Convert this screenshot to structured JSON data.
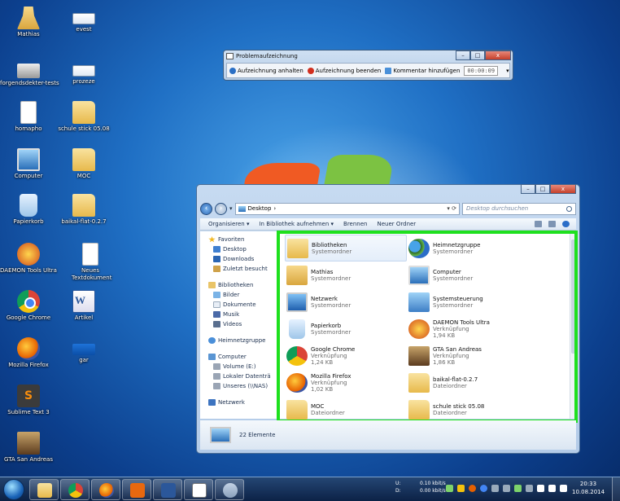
{
  "desktop": {
    "icons": [
      {
        "label": "Mathias",
        "icon": "user-folder-icon"
      },
      {
        "label": "evest",
        "icon": "window-icon"
      },
      {
        "label": "forgendsdekter-tests",
        "icon": "scanner-icon"
      },
      {
        "label": "prozeze",
        "icon": "window-icon"
      },
      {
        "label": "homapho",
        "icon": "document-icon"
      },
      {
        "label": "schule stick 05.08",
        "icon": "folder-icon"
      },
      {
        "label": "Computer",
        "icon": "computer-icon"
      },
      {
        "label": "MOC",
        "icon": "folder-icon"
      },
      {
        "label": "Papierkorb",
        "icon": "recycle-bin-icon"
      },
      {
        "label": "baikal-flat-0.2.7",
        "icon": "folder-icon"
      },
      {
        "label": "DAEMON Tools Ultra",
        "icon": "daemon-tools-icon"
      },
      {
        "label": "Neues Textdokument",
        "icon": "document-icon"
      },
      {
        "label": "Google Chrome",
        "icon": "chrome-icon"
      },
      {
        "label": "Artikel",
        "icon": "word-document-icon"
      },
      {
        "label": "Mozilla Firefox",
        "icon": "firefox-icon"
      },
      {
        "label": "gar",
        "icon": "blue-window-icon"
      },
      {
        "label": "Sublime Text 3",
        "icon": "sublime-text-icon"
      },
      {
        "label": "GTA San Andreas",
        "icon": "gta-icon"
      }
    ]
  },
  "recorder": {
    "title": "Problemaufzeichnung",
    "pause_label": "Aufzeichnung anhalten",
    "stop_label": "Aufzeichnung beenden",
    "comment_label": "Kommentar hinzufügen",
    "timer": "00:00:09",
    "close": "x",
    "minimize": "–",
    "maximize": "□"
  },
  "explorer": {
    "address": "Desktop",
    "search_placeholder": "Desktop durchsuchen",
    "toolbar": {
      "organize": "Organisieren ▾",
      "include": "In Bibliothek aufnehmen ▾",
      "burn": "Brennen",
      "new_folder": "Neuer Ordner"
    },
    "nav": {
      "favorites": "Favoriten",
      "fav_items": [
        "Desktop",
        "Downloads",
        "Zuletzt besucht"
      ],
      "libraries": "Bibliotheken",
      "lib_items": [
        "Bilder",
        "Dokumente",
        "Musik",
        "Videos"
      ],
      "homegroup": "Heimnetzgruppe",
      "computer": "Computer",
      "comp_items": [
        "Volume (E:)",
        "Lokaler Datenträ",
        "Unseres (\\\\NAS)"
      ],
      "network": "Netzwerk"
    },
    "items": [
      {
        "name": "Bibliotheken",
        "sub": "Systemordner",
        "sub2": "",
        "icon": "library-icon"
      },
      {
        "name": "Heimnetzgruppe",
        "sub": "Systemordner",
        "sub2": "",
        "icon": "homegroup-icon"
      },
      {
        "name": "Mathias",
        "sub": "Systemordner",
        "sub2": "",
        "icon": "user-folder-icon"
      },
      {
        "name": "Computer",
        "sub": "Systemordner",
        "sub2": "",
        "icon": "computer-icon"
      },
      {
        "name": "Netzwerk",
        "sub": "Systemordner",
        "sub2": "",
        "icon": "network-icon"
      },
      {
        "name": "Systemsteuerung",
        "sub": "Systemordner",
        "sub2": "",
        "icon": "control-panel-icon"
      },
      {
        "name": "Papierkorb",
        "sub": "Systemordner",
        "sub2": "",
        "icon": "recycle-bin-icon"
      },
      {
        "name": "DAEMON Tools Ultra",
        "sub": "Verknüpfung",
        "sub2": "1,94 KB",
        "icon": "daemon-tools-icon"
      },
      {
        "name": "Google Chrome",
        "sub": "Verknüpfung",
        "sub2": "1,24 KB",
        "icon": "chrome-icon"
      },
      {
        "name": "GTA San Andreas",
        "sub": "Verknüpfung",
        "sub2": "1,86 KB",
        "icon": "gta-icon"
      },
      {
        "name": "Mozilla Firefox",
        "sub": "Verknüpfung",
        "sub2": "1,02 KB",
        "icon": "firefox-icon"
      },
      {
        "name": "baikal-flat-0.2.7",
        "sub": "Dateiordner",
        "sub2": "",
        "icon": "folder-icon"
      },
      {
        "name": "MOC",
        "sub": "Dateiordner",
        "sub2": "",
        "icon": "folder-icon"
      },
      {
        "name": "schule stick 05.08",
        "sub": "Dateiordner",
        "sub2": "",
        "icon": "folder-icon"
      }
    ],
    "status": "22 Elemente"
  },
  "taskbar": {
    "net_u_label": "U:",
    "net_d_label": "D:",
    "net_u": "0.10 kbit/s",
    "net_d": "0.00 kbit/s",
    "time": "20:33",
    "date": "10.08.2014"
  }
}
